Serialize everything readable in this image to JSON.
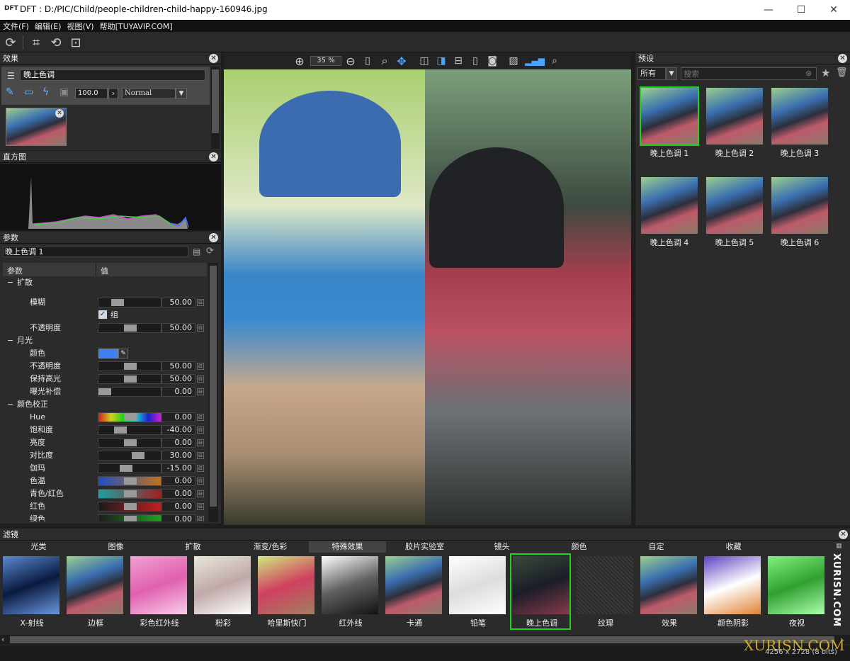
{
  "window": {
    "logo": "DFT",
    "title": "DFT : D:/PIC/Child/people-children-child-happy-160946.jpg",
    "min": "—",
    "max": "☐",
    "close": "✕"
  },
  "menu": [
    "文件(F)",
    "编辑(E)",
    "视图(V)",
    "帮助[TUYAVIP.COM]"
  ],
  "effects": {
    "title": "效果",
    "current_effect": "晚上色调",
    "opacity": "100.0",
    "blend_mode": "Normal"
  },
  "histogram": {
    "title": "直方图"
  },
  "params": {
    "title": "参数",
    "preset_name": "晚上色调 1",
    "col_param": "参数",
    "col_value": "值",
    "groups": [
      {
        "name": "扩散",
        "items": [
          {
            "label": "模糊",
            "value": "50.00",
            "knob": 0.25
          },
          {
            "label": "组",
            "checkbox": true
          },
          {
            "label": "不透明度",
            "value": "50.00",
            "knob": 0.5
          }
        ]
      },
      {
        "name": "月光",
        "items": [
          {
            "label": "颜色",
            "color": "#3f7ff0"
          },
          {
            "label": "不透明度",
            "value": "50.00",
            "knob": 0.5
          },
          {
            "label": "保持高光",
            "value": "50.00",
            "knob": 0.5
          },
          {
            "label": "曝光补偿",
            "value": "0.00",
            "knob": 0.0
          }
        ]
      },
      {
        "name": "颜色校正",
        "items": [
          {
            "label": "Hue",
            "value": "0.00",
            "knob": 0.5,
            "grad": "hue"
          },
          {
            "label": "饱和度",
            "value": "-40.00",
            "knob": 0.3
          },
          {
            "label": "亮度",
            "value": "0.00",
            "knob": 0.5
          },
          {
            "label": "对比度",
            "value": "30.00",
            "knob": 0.65
          },
          {
            "label": "伽玛",
            "value": "-15.00",
            "knob": 0.42
          },
          {
            "label": "色温",
            "value": "0.00",
            "knob": 0.5,
            "grad": "temp"
          },
          {
            "label": "青色/红色",
            "value": "0.00",
            "knob": 0.5,
            "grad": "cr"
          },
          {
            "label": "红色",
            "value": "0.00",
            "knob": 0.5,
            "grad": "red"
          },
          {
            "label": "绿色",
            "value": "0.00",
            "knob": 0.5,
            "grad": "green"
          }
        ]
      }
    ]
  },
  "viewer": {
    "zoom": "35 %"
  },
  "presets": {
    "title": "预设",
    "filter": "所有",
    "search_placeholder": "搜索",
    "items": [
      "晚上色调 1",
      "晚上色调 2",
      "晚上色调 3",
      "晚上色调 4",
      "晚上色调 5",
      "晚上色调 6"
    ]
  },
  "filters": {
    "title": "滤镜",
    "tabs": [
      "光类",
      "图像",
      "扩散",
      "渐变/色彩",
      "特殊效果",
      "胶片实验室",
      "镜头",
      "颜色",
      "自定",
      "收藏"
    ],
    "active_tab": 4,
    "items": [
      "X-射线",
      "边框",
      "彩色红外线",
      "粉彩",
      "哈里斯快门",
      "红外线",
      "卡通",
      "铅笔",
      "晚上色调",
      "纹理",
      "效果",
      "颜色阴影",
      "夜视"
    ],
    "selected": 8
  },
  "status": {
    "dimensions": "4256 x 2728 (8 bits)"
  },
  "watermark": {
    "side": "XURISN.COM",
    "corner": "XURISN.COM"
  }
}
